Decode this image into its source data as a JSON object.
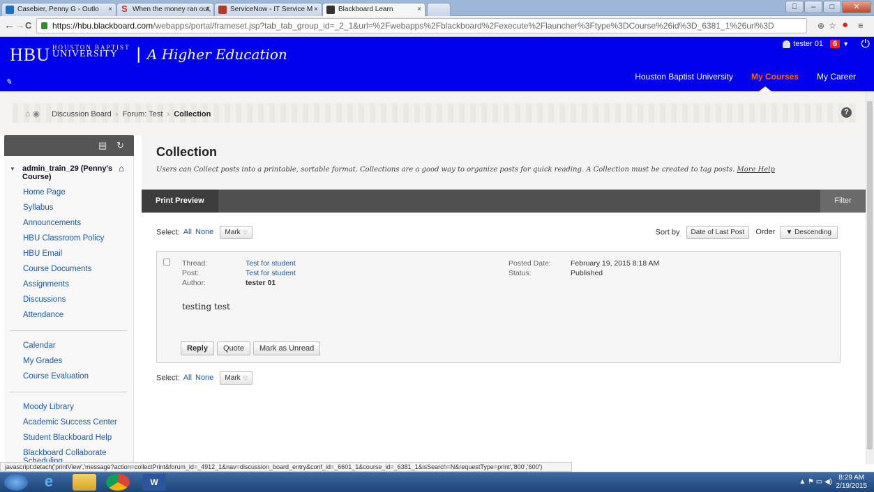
{
  "browser": {
    "tabs": [
      {
        "label": "Casebier, Penny G - Outlo",
        "color": "#1e6fc2"
      },
      {
        "label": "When the money ran out,",
        "color": "#c0392b"
      },
      {
        "label": "ServiceNow - IT Service M",
        "color": "#b03a2e"
      },
      {
        "label": "Blackboard Learn",
        "color": "#333333"
      }
    ],
    "url_host": "https://hbu.blackboard.com",
    "url_path": "/webapps/portal/frameset.jsp?tab_tab_group_id=_2_1&url=%2Fwebapps%2Fblackboard%2Fexecute%2Flauncher%3Ftype%3DCourse%26id%3D_6381_1%26url%3D"
  },
  "header": {
    "logo_main": "HBU",
    "logo_sub1": "HOUSTON BAPTIST",
    "logo_sub2": "UNIVERSITY",
    "logo_sep": "|",
    "tagline": "A Higher Education",
    "user": "tester 01",
    "notifications": "6",
    "nav": [
      "Houston Baptist University",
      "My Courses",
      "My Career"
    ],
    "accent": "#0000ee"
  },
  "breadcrumb": {
    "items": [
      "Discussion Board",
      "Forum: Test"
    ],
    "current": "Collection",
    "sep": "›"
  },
  "sidebar": {
    "course": "admin_train_29 (Penny's Course)",
    "group1": [
      "Home Page",
      "Syllabus",
      "Announcements",
      "HBU Classroom Policy",
      "HBU Email",
      "Course Documents",
      "Assignments",
      "Discussions",
      "Attendance"
    ],
    "group2": [
      "Calendar",
      "My Grades",
      "Course Evaluation"
    ],
    "group3": [
      "Moody Library",
      "Academic Success Center",
      "Student Blackboard Help",
      "Blackboard Collaborate",
      "Scheduling"
    ]
  },
  "page": {
    "title": "Collection",
    "description": "Users can Collect posts into a printable, sortable format. Collections are a good way to organize posts for quick reading. A Collection must be created to tag posts.",
    "more_help": "More Help",
    "print_preview": "Print Preview",
    "filter": "Filter",
    "select_label": "Select:",
    "select_all": "All",
    "select_none": "None",
    "mark": "Mark",
    "sort_by_label": "Sort by",
    "sort_by_value": "Date of Last Post",
    "order_label": "Order",
    "order_value": "▼ Descending"
  },
  "post": {
    "thread_label": "Thread:",
    "thread": "Test for student",
    "post_label": "Post:",
    "post": "Test for student",
    "author_label": "Author:",
    "author": "tester 01",
    "posted_label": "Posted Date:",
    "posted": "February 19, 2015 8:18 AM",
    "status_label": "Status:",
    "status": "Published",
    "body": "testing test",
    "buttons": [
      "Reply",
      "Quote",
      "Mark as Unread"
    ]
  },
  "statusbar": "javascript:detach('printView','message?action=collectPrint&forum_id=_4912_1&nav=discussion_board_entry&conf_id=_6601_1&course_id=_6381_1&isSearch=N&requestType=print','800','600')",
  "taskbar": {
    "time": "8:29 AM",
    "date": "2/19/2015"
  }
}
